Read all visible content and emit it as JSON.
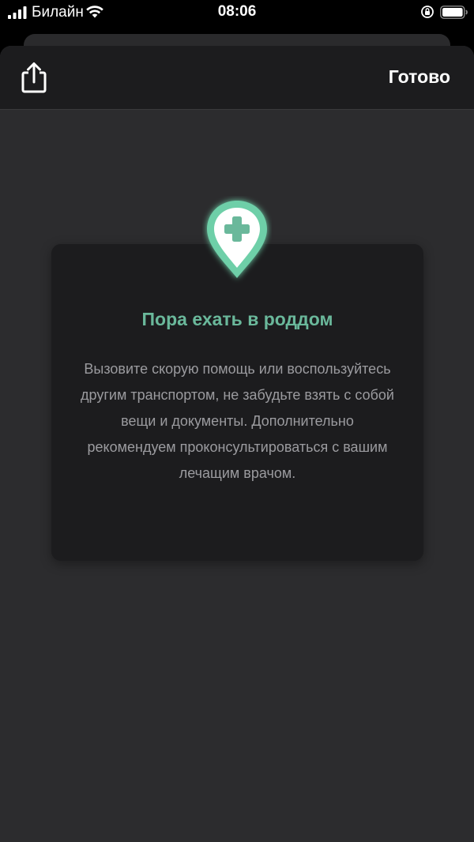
{
  "status_bar": {
    "carrier": "Билайн",
    "time": "08:06"
  },
  "sheet": {
    "done_label": "Готово",
    "share_icon": "share-icon"
  },
  "card": {
    "icon": "medical-location-pin-icon",
    "title": "Пора ехать в роддом",
    "body": "Вызовите скорую помощь или воспользуйтесь другим транспортом, не забудьте взять с собой вещи и документы. Дополнительно рекомендуем проконсультироваться с вашим лечащим врачом."
  },
  "colors": {
    "accent": "#6ab89b",
    "sheet_bg": "#2c2c2e",
    "card_bg": "#1c1c1e",
    "body_text": "#9b9b9f"
  }
}
